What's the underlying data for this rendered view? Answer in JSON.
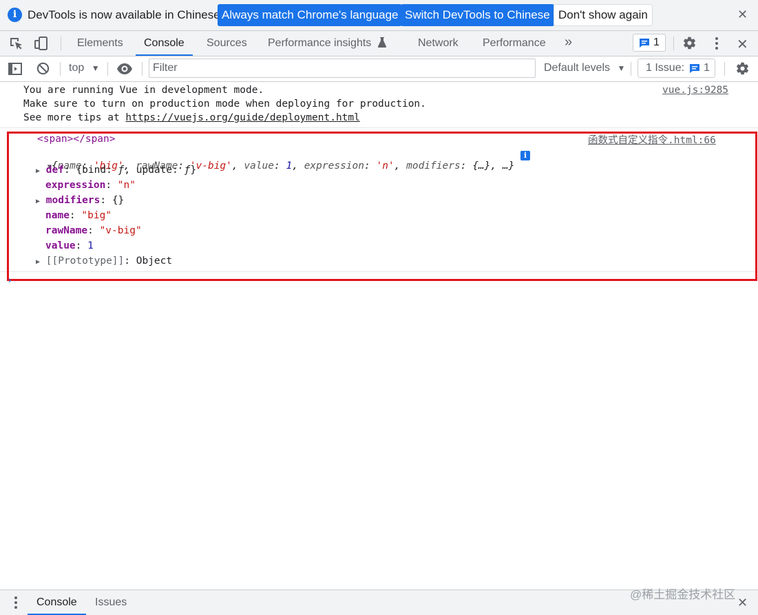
{
  "infobar": {
    "message": "DevTools is now available in Chinese!",
    "btn_match": "Always match Chrome's language",
    "btn_switch": "Switch DevTools to Chinese",
    "btn_dont_show": "Don't show again",
    "close": "✕"
  },
  "tabs": [
    "Elements",
    "Console",
    "Sources",
    "Performance insights",
    "Network",
    "Performance"
  ],
  "tabbar": {
    "more": "»",
    "message_count": "1",
    "close": "✕"
  },
  "toolbar": {
    "context": "top",
    "filter_placeholder": "Filter",
    "levels": "Default levels",
    "issues_label": "1 Issue:",
    "issues_count": "1"
  },
  "console": {
    "vue_lines": [
      "You are running Vue in development mode.",
      "Make sure to turn on production mode when deploying for production.",
      "See more tips at "
    ],
    "vue_link": "https://vuejs.org/guide/deployment.html",
    "vue_source": "vue.js:9285",
    "span_line": "<span></span>",
    "obj_source": "函数式自定义指令.html:66",
    "summary": {
      "open": "{",
      "k1": "name",
      "v1": "'big'",
      "k2": "rawName",
      "v2": "'v-big'",
      "k3": "value",
      "v3": "1",
      "k4": "expression",
      "v4": "'n'",
      "k5": "modifiers",
      "v5": "{…}",
      "tail": ", …}"
    },
    "props": {
      "def_key": "def",
      "def_val_open": "{bind: ",
      "def_f": "ƒ",
      "def_mid": ", update: ",
      "def_close": "}",
      "expression_key": "expression",
      "expression_val": "\"n\"",
      "modifiers_key": "modifiers",
      "modifiers_val": "{}",
      "name_key": "name",
      "name_val": "\"big\"",
      "rawname_key": "rawName",
      "rawname_val": "\"v-big\"",
      "value_key": "value",
      "value_val": "1",
      "proto_key": "[[Prototype]]",
      "proto_val": "Object"
    },
    "prompt": "›"
  },
  "drawer": {
    "tabs": [
      "Console",
      "Issues"
    ],
    "close": "✕"
  },
  "watermark": "@稀土掘金技术社区",
  "colors": {
    "accent": "#1a73e8",
    "highlight_box": "#e0141e",
    "key": "#881391",
    "string": "#c41a16",
    "number": "#1a1aa6"
  }
}
